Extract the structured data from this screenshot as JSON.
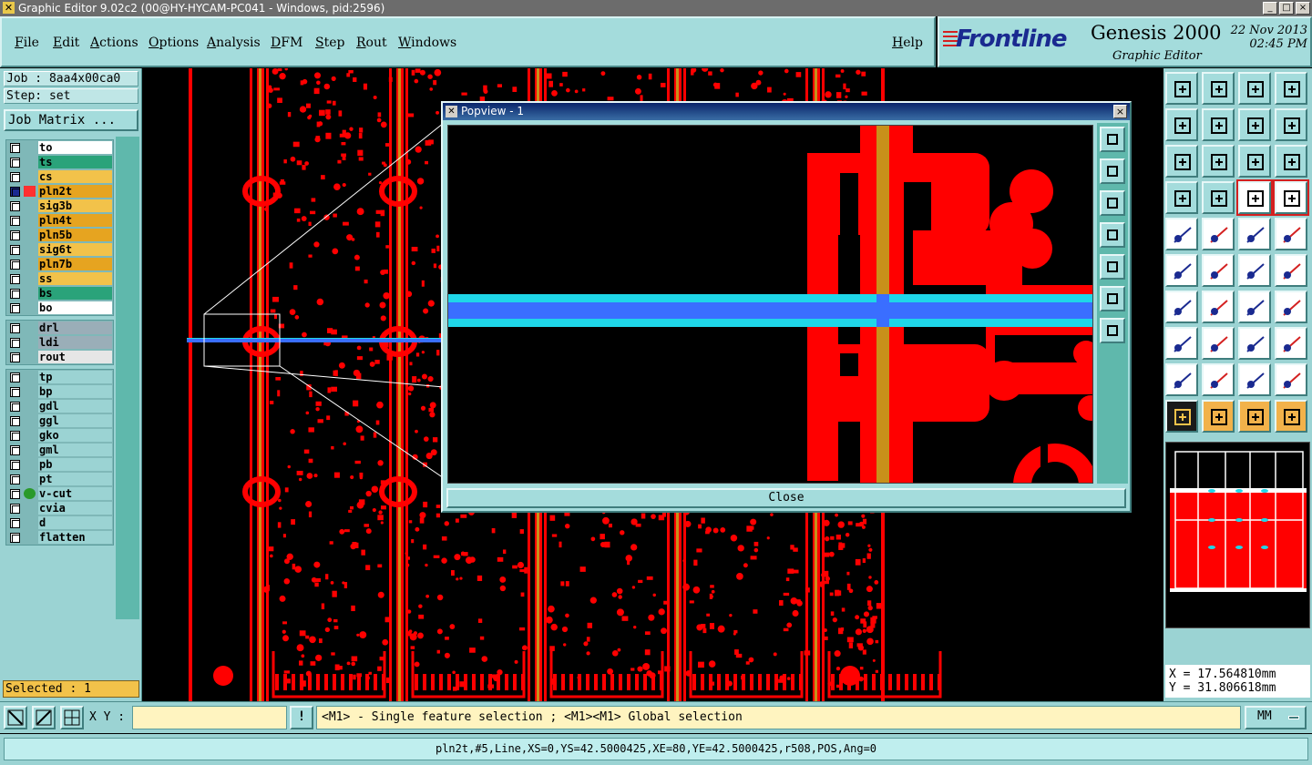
{
  "window": {
    "title": "Graphic Editor 9.02c2 (00@HY-HYCAM-PC041 - Windows, pid:2596)",
    "buttons": [
      "_",
      "□",
      "×"
    ]
  },
  "menu": {
    "items": [
      "File",
      "Edit",
      "Actions",
      "Options",
      "Analysis",
      "DFM",
      "Step",
      "Rout",
      "Windows"
    ],
    "help": "Help"
  },
  "brand": {
    "logo": "Frontline",
    "product": "Genesis 2000",
    "subtitle": "Graphic Editor",
    "date": "22 Nov 2013",
    "time": "02:45 PM"
  },
  "job": {
    "job_label": "Job : 8aa4x00ca0",
    "step_label": "Step: set",
    "matrix_button": "Job Matrix ...",
    "selected": "Selected : 1"
  },
  "layers": {
    "board": [
      {
        "name": "to",
        "color": "#ffffff"
      },
      {
        "name": "ts",
        "color": "#2aa37a"
      },
      {
        "name": "cs",
        "color": "#f2c24a"
      },
      {
        "name": "pln2t",
        "color": "#e6a420",
        "work": true
      },
      {
        "name": "sig3b",
        "color": "#f2c24a"
      },
      {
        "name": "pln4t",
        "color": "#e6a420"
      },
      {
        "name": "pln5b",
        "color": "#e6a420"
      },
      {
        "name": "sig6t",
        "color": "#f2c24a"
      },
      {
        "name": "pln7b",
        "color": "#e6a420"
      },
      {
        "name": "ss",
        "color": "#f2c24a"
      },
      {
        "name": "bs",
        "color": "#2aa37a"
      },
      {
        "name": "bo",
        "color": "#ffffff"
      }
    ],
    "drill": [
      {
        "name": "drl",
        "color": "#9aaeb8"
      },
      {
        "name": "ldi",
        "color": "#9aaeb8"
      },
      {
        "name": "rout",
        "color": "#e6e6e6"
      }
    ],
    "misc": [
      {
        "name": "tp",
        "color": "#9bd3d3"
      },
      {
        "name": "bp",
        "color": "#9bd3d3"
      },
      {
        "name": "gdl",
        "color": "#9bd3d3"
      },
      {
        "name": "ggl",
        "color": "#9bd3d3"
      },
      {
        "name": "gko",
        "color": "#9bd3d3"
      },
      {
        "name": "gml",
        "color": "#9bd3d3"
      },
      {
        "name": "pb",
        "color": "#9bd3d3"
      },
      {
        "name": "pt",
        "color": "#9bd3d3"
      },
      {
        "name": "v-cut",
        "color": "#9bd3d3",
        "dot": true
      },
      {
        "name": "cvia",
        "color": "#9bd3d3"
      },
      {
        "name": "d",
        "color": "#9bd3d3"
      },
      {
        "name": "flatten",
        "color": "#9bd3d3"
      }
    ]
  },
  "popview": {
    "title": "Popview - 1",
    "close_label": "Close",
    "close_icon": "×"
  },
  "coords": {
    "x": "X = 17.564810mm",
    "y": "Y = 31.806618mm"
  },
  "bottom": {
    "xy_label": "X Y :",
    "xy_value": "",
    "bang": "!",
    "hint": "<M1> - Single feature selection ; <M1><M1> Global selection",
    "units": "MM"
  },
  "status": {
    "feature": "pln2t,#5,Line,XS=0,YS=42.5000425,XE=80,YE=42.5000425,r508,POS,Ang=0"
  },
  "colors": {
    "copper": "#ff0000",
    "highlight": "#1fd6e8",
    "selection": "#3a6eff",
    "panel": "#9bd3d3"
  }
}
